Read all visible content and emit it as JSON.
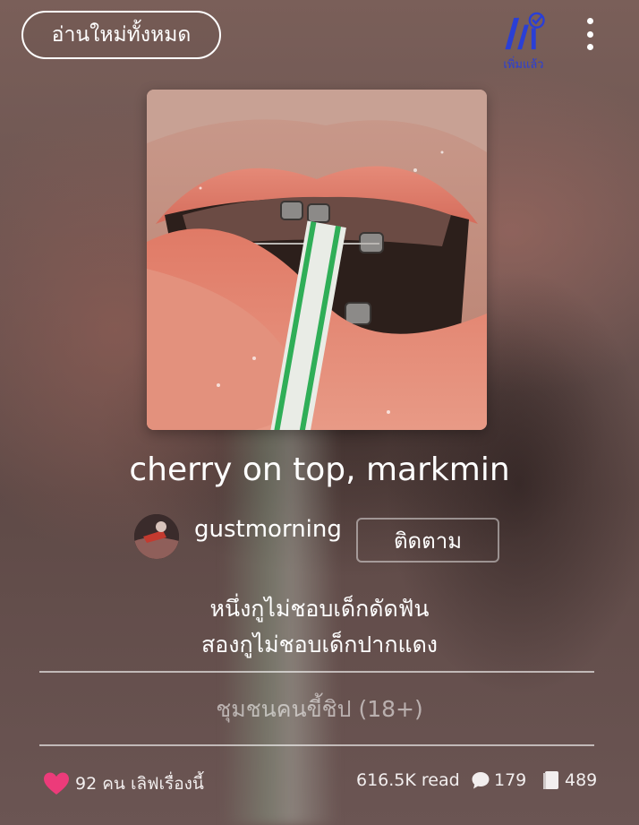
{
  "header": {
    "read_all_label": "อ่านใหม่ทั้งหมด",
    "library_status_label": "เพิ่มแล้ว",
    "library_icon": "library-added-icon",
    "more_icon": "more-vertical-icon"
  },
  "story": {
    "title": "cherry on top, markmin",
    "cover_icon": "story-cover-image",
    "author": {
      "name": "gustmorning",
      "follow_label": "ติดตาม"
    },
    "description_line1": "หนึ่งกูไม่ชอบเด็กดัดฟัน",
    "description_line2": "สองกูไม่ชอบเด็กปากแดง",
    "category": "ชุมชนคนขี้ชิป (18+)"
  },
  "stats": {
    "loves": "92 คน เลิฟเรื่องนี้",
    "reads": "616.5K read",
    "comments": "179",
    "parts": "489"
  },
  "colors": {
    "accent_blue": "#2a3fd6",
    "heart_pink": "#ec3b7a",
    "straw_green": "#2fae57"
  }
}
